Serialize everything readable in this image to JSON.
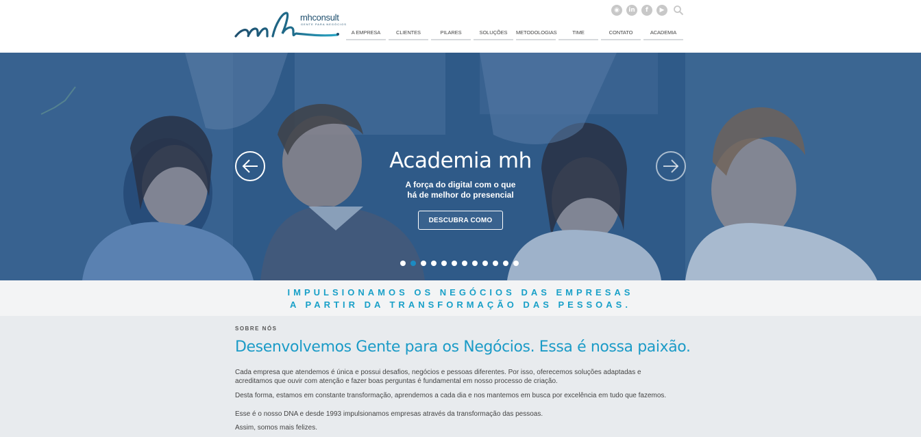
{
  "header": {
    "logo_text": "mhconsult",
    "logo_tagline": "GENTE PARA NEGÓCIOS",
    "social_icons": [
      "globe-icon",
      "linkedin-icon",
      "facebook-icon",
      "youtube-icon"
    ],
    "nav": [
      "A EMPRESA",
      "CLIENTES",
      "PILARES",
      "SOLUÇÕES",
      "METODOLOGIAS",
      "TIME",
      "CONTATO",
      "ACADEMIA"
    ]
  },
  "hero": {
    "title": "Academia mh",
    "subtitle_line1": "A força do digital com o que",
    "subtitle_line2": "há de melhor do presencial",
    "button": "DESCUBRA COMO",
    "slide_count": 12,
    "active_slide": 2
  },
  "band": {
    "line1": "IMPULSIONAMOS OS NEGÓCIOS DAS EMPRESAS",
    "line2": "A PARTIR DA TRANSFORMAÇÃO DAS PESSOAS."
  },
  "about": {
    "label": "SOBRE NÓS",
    "title": "Desenvolvemos Gente para os Negócios. Essa é nossa paixão.",
    "p1": "Cada empresa que atendemos é única e possui desafios, negócios e pessoas diferentes. Por isso, oferecemos soluções adaptadas e acreditamos que ouvir com atenção e fazer boas perguntas é fundamental em nosso processo de criação.",
    "p2": "Desta forma, estamos em constante transformação, aprendemos a cada dia e nos mantemos em busca por excelência em tudo que fazemos.",
    "p3": "Esse é o nosso DNA e desde 1993 impulsionamos empresas através da transformação das pessoas.",
    "p4": "Assim, somos mais felizes."
  },
  "colors": {
    "accent": "#1b9bc7",
    "brand_dark": "#1f4f6e",
    "hero_overlay": "#2c5585"
  }
}
